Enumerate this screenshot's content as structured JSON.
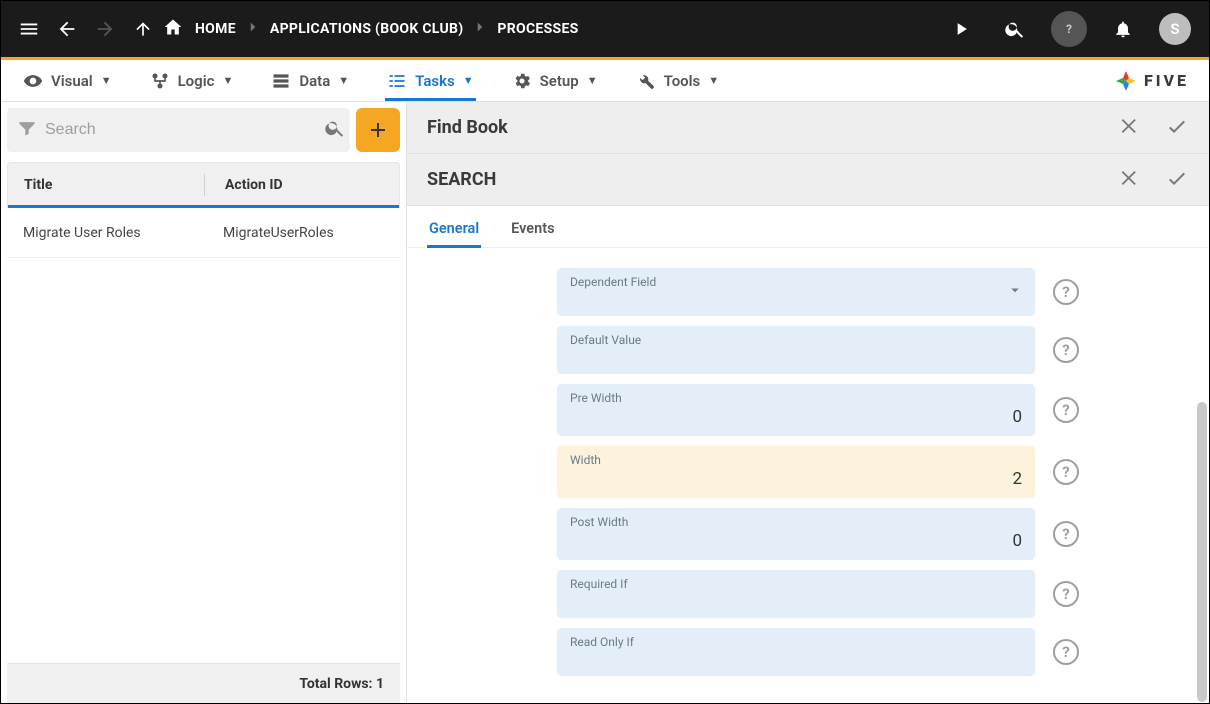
{
  "topbar": {
    "home_label": "HOME",
    "crumb_app": "APPLICATIONS (BOOK CLUB)",
    "crumb_page": "PROCESSES",
    "avatar_initial": "S"
  },
  "nav": {
    "visual": "Visual",
    "logic": "Logic",
    "data": "Data",
    "tasks": "Tasks",
    "setup": "Setup",
    "tools": "Tools",
    "brand": "FIVE"
  },
  "left": {
    "search_placeholder": "Search",
    "col_title": "Title",
    "col_action": "Action ID",
    "rows": [
      {
        "title": "Migrate User Roles",
        "action": "MigrateUserRoles"
      }
    ],
    "footer": "Total Rows: 1"
  },
  "panel": {
    "title1": "Find Book",
    "title2": "SEARCH",
    "tab_general": "General",
    "tab_events": "Events",
    "fields": {
      "dependent_label": "Dependent Field",
      "default_label": "Default Value",
      "prewidth_label": "Pre Width",
      "prewidth_value": "0",
      "width_label": "Width",
      "width_value": "2",
      "postwidth_label": "Post Width",
      "postwidth_value": "0",
      "required_label": "Required If",
      "readonly_label": "Read Only If"
    },
    "help_glyph": "?"
  }
}
